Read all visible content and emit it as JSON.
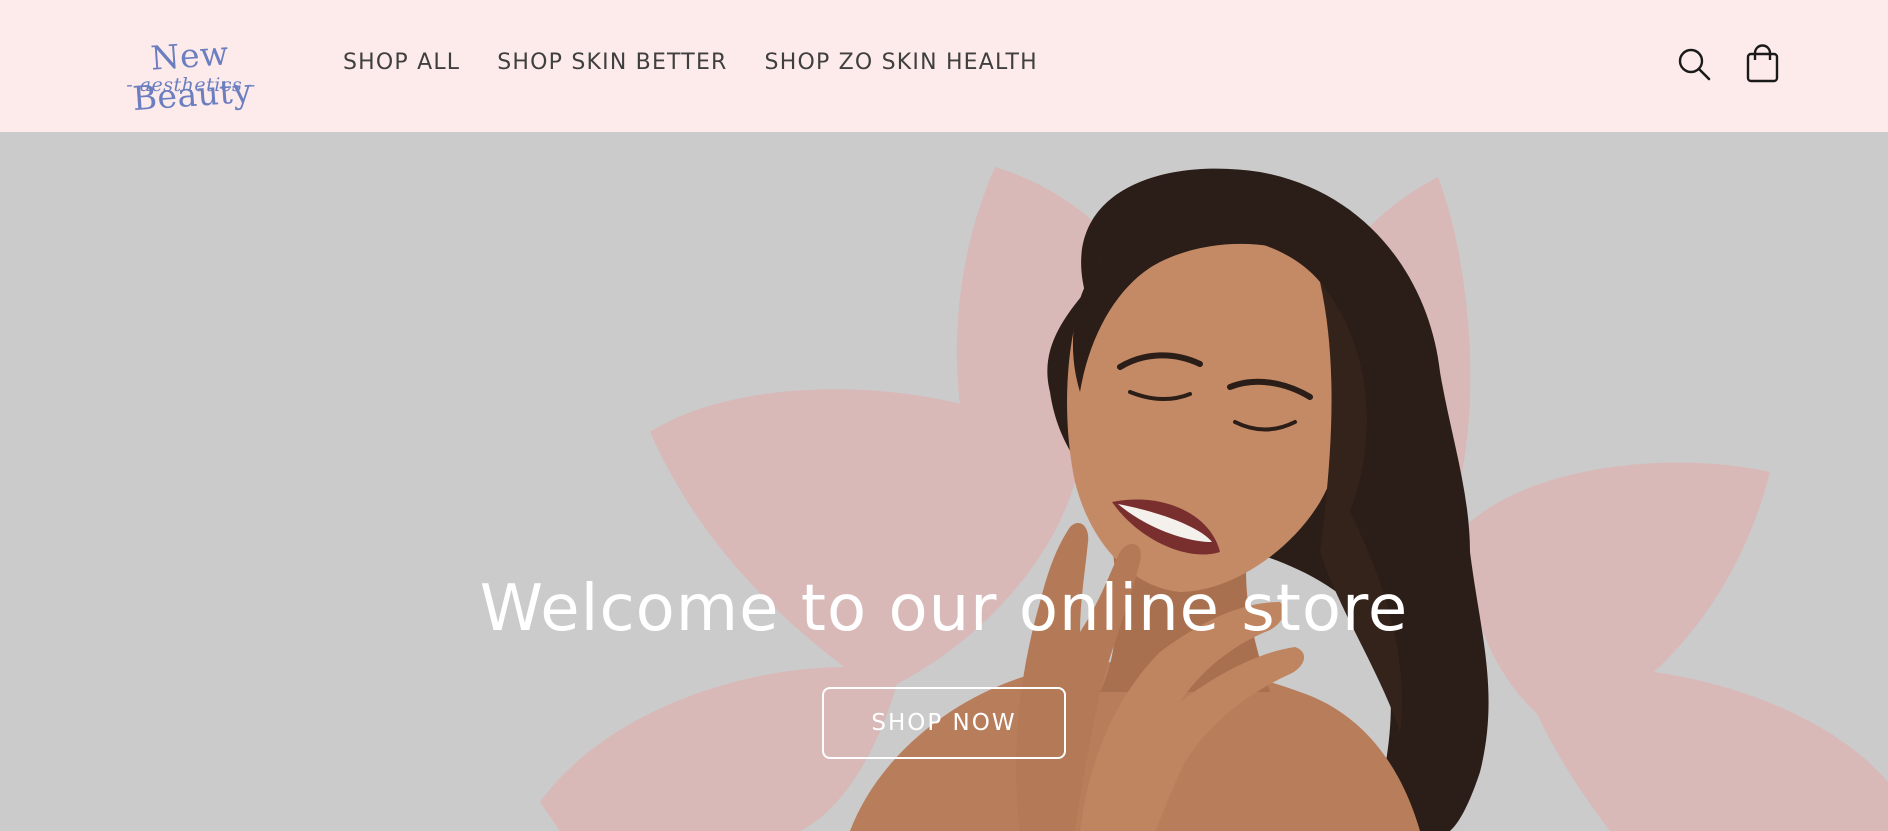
{
  "brand": {
    "logo_line1": "New Beauty",
    "logo_line2": "- aesthetics -",
    "color": "#6b7fc0"
  },
  "nav": {
    "items": [
      {
        "label": "SHOP ALL"
      },
      {
        "label": "SHOP SKIN BETTER"
      },
      {
        "label": "SHOP ZO SKIN HEALTH"
      }
    ]
  },
  "header_icons": [
    "search-icon",
    "cart-icon"
  ],
  "hero": {
    "title": "Welcome to our online store",
    "button_label": "SHOP NOW",
    "background_color": "#cbcbcb",
    "petal_color": "#e6a9a9"
  },
  "colors": {
    "header_bg": "#fdeaea",
    "nav_text": "#3f3f3f"
  }
}
